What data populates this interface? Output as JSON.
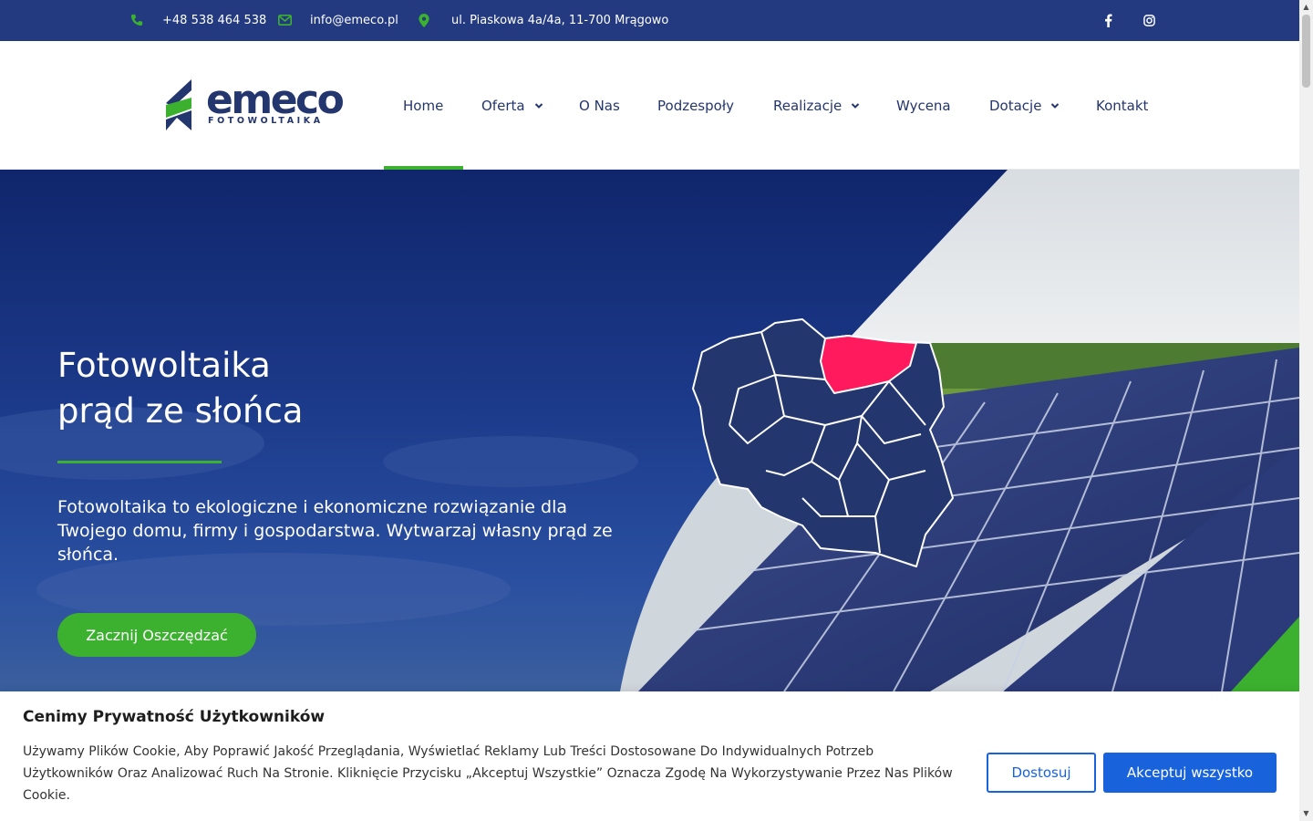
{
  "topbar": {
    "phone": "+48 538 464 538",
    "email": "info@emeco.pl",
    "address": "ul. Piaskowa 4a/4a, 11-700 Mrągowo",
    "phone_icon": "phone-icon",
    "email_icon": "envelope-icon",
    "address_icon": "map-marker-icon",
    "social": [
      "facebook-icon",
      "instagram-icon"
    ]
  },
  "logo": {
    "word": "emeco",
    "sub": "FOTOWOLTAIKA"
  },
  "nav": {
    "items": [
      {
        "label": "Home",
        "active": true
      },
      {
        "label": "Oferta",
        "dropdown": true
      },
      {
        "label": "O Nas"
      },
      {
        "label": "Podzespoły"
      },
      {
        "label": "Realizacje",
        "dropdown": true
      },
      {
        "label": "Wycena"
      },
      {
        "label": "Dotacje",
        "dropdown": true
      },
      {
        "label": "Kontakt"
      }
    ]
  },
  "hero": {
    "title_line1": "Fotowoltaika",
    "title_line2": "prąd ze słońca",
    "text": "Fotowoltaika to ekologiczne i ekonomiczne rozwiązanie dla Twojego domu, firmy i gospodarstwa. Wytwarzaj własny prąd ze słońca.",
    "cta": "Zacznij Oszczędzać"
  },
  "cookie": {
    "title": "Cenimy Prywatność Użytkowników",
    "text": "Używamy Plików Cookie, Aby Poprawić Jakość Przeglądania, Wyświetlać Reklamy Lub Treści Dostosowane Do Indywidualnych Potrzeb Użytkowników Oraz Analizować Ruch Na Stronie. Kliknięcie Przycisku „Akceptuj Wszystkie” Oznacza Zgodę Na Wykorzystywanie Przez Nas Plików Cookie.",
    "customize": "Dostosuj",
    "accept": "Akceptuj wszystko"
  },
  "colors": {
    "brand_navy": "#233a80",
    "brand_green": "#3cb02f",
    "highlight_region": "#ff1a5e",
    "cookie_blue": "#1863dc"
  }
}
